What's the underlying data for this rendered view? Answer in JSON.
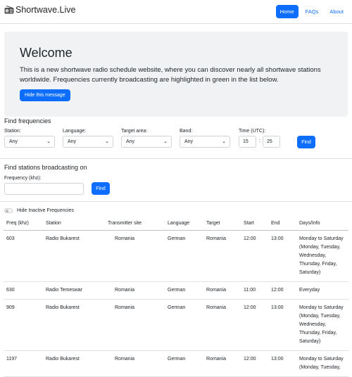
{
  "navbar": {
    "brand": "Shortwave.Live",
    "links": [
      "Home",
      "FAQs",
      "About"
    ]
  },
  "welcome": {
    "title": "Welcome",
    "text": "This is a new shortwave radio schedule website, where you can discover nearly all shortwave stations worldwide. Frequencies currently broadcasting are highlighted in green in the list below.",
    "hide_button": "Hide this message"
  },
  "find_frequencies": {
    "title": "Find frequencies",
    "station_label": "Station:",
    "station_value": "Any",
    "language_label": "Language:",
    "language_value": "Any",
    "target_label": "Target area:",
    "target_value": "Any",
    "band_label": "Band:",
    "band_value": "Any",
    "time_label": "Time (UTC):",
    "time_hour": "15",
    "time_sep": ":",
    "time_minute": "25",
    "find_button": "Find"
  },
  "find_stations": {
    "title": "Find stations broadcasting on",
    "frequency_label": "Frequency (khz):",
    "frequency_value": "",
    "find_button": "Find"
  },
  "toggle_label": "Hide Inactive Frequencies",
  "table": {
    "headers": [
      "Freq (khz)",
      "Station",
      "Transmitter site",
      "Language",
      "Target",
      "Start",
      "End",
      "Days/Info"
    ],
    "rows": [
      {
        "freq": "603",
        "station": "Radio Bukarest",
        "site": "Romania",
        "language": "German",
        "target": "Romania",
        "start": "12:00",
        "end": "13:00",
        "days": "Monday to Saturday (Monday, Tuesday, Wednesday, Thursday, Friday, Saturday)"
      },
      {
        "freq": "630",
        "station": "Radio Temeswar",
        "site": "Romania",
        "language": "German",
        "target": "Romania",
        "start": "11:00",
        "end": "12:00",
        "days": "Everyday"
      },
      {
        "freq": "909",
        "station": "Radio Bukarest",
        "site": "Romania",
        "language": "German",
        "target": "Romania",
        "start": "12:00",
        "end": "13:00",
        "days": "Monday to Saturday (Monday, Tuesday, Wednesday, Thursday, Friday, Saturday)"
      },
      {
        "freq": "1197",
        "station": "Radio Bukarest",
        "site": "Romania",
        "language": "German",
        "target": "Romania",
        "start": "12:00",
        "end": "13:00",
        "days": "Monday to Saturday (Monday, Tuesday,"
      }
    ]
  },
  "icons": {
    "brand": "radio-icon",
    "select": "chevron-down-icon"
  },
  "colors": {
    "accent": "#0d6efd",
    "jumbotron": "#f0f2f4"
  }
}
